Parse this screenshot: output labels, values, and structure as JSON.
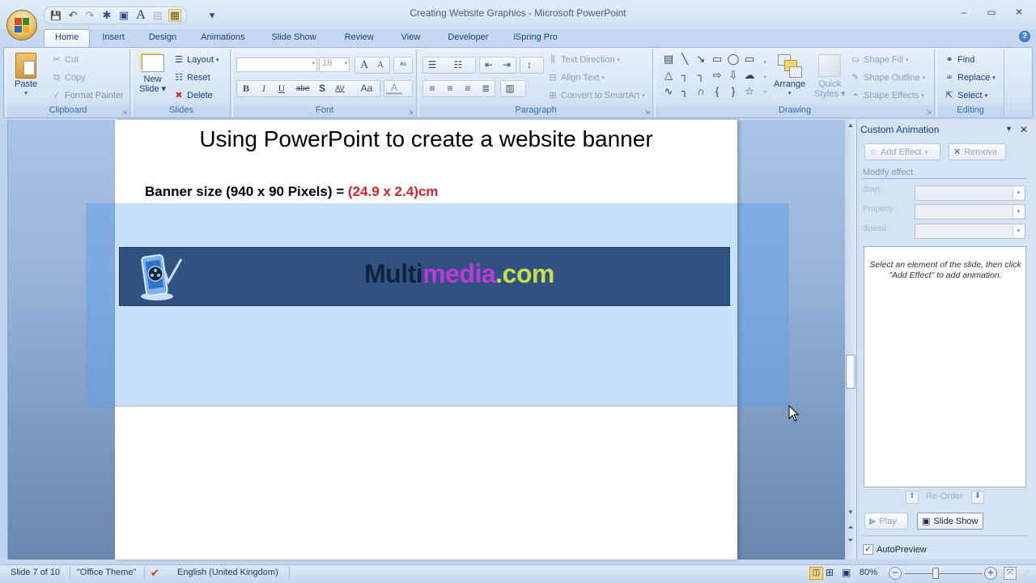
{
  "window": {
    "title": "Creating Website Graphics - Microsoft PowerPoint",
    "controls": {
      "minimize": "–",
      "maximize": "▭",
      "close": "✕"
    }
  },
  "quick_access": [
    {
      "name": "save-icon",
      "glyph": "💾"
    },
    {
      "name": "undo-icon",
      "glyph": "↶"
    },
    {
      "name": "redo-icon",
      "glyph": "↷"
    },
    {
      "name": "shapes-icon",
      "glyph": "✱"
    },
    {
      "name": "picture-icon",
      "glyph": "▣"
    },
    {
      "name": "wordart-icon",
      "glyph": "A"
    },
    {
      "name": "textbox-icon",
      "glyph": "▤"
    },
    {
      "name": "slideshow-icon",
      "glyph": "▦"
    },
    {
      "name": "customize-qat-icon",
      "glyph": "▾"
    }
  ],
  "tabs": [
    "Home",
    "Insert",
    "Design",
    "Animations",
    "Slide Show",
    "Review",
    "View",
    "Developer",
    "iSpring Pro"
  ],
  "active_tab": "Home",
  "ribbon": {
    "clipboard": {
      "label": "Clipboard",
      "paste": "Paste",
      "cut": "Cut",
      "copy": "Copy",
      "format_painter": "Format Painter"
    },
    "slides": {
      "label": "Slides",
      "new_slide_1": "New",
      "new_slide_2": "Slide",
      "layout": "Layout",
      "reset": "Reset",
      "delete": "Delete"
    },
    "font": {
      "label": "Font",
      "font_name": "",
      "font_size": "18",
      "bold": "B",
      "italic": "I",
      "underline": "U",
      "strike": "abe",
      "shadow": "S",
      "spacing": "AV",
      "case": "Aa",
      "grow": "A",
      "shrink": "A",
      "clear": "A"
    },
    "paragraph": {
      "label": "Paragraph",
      "text_direction": "Text Direction",
      "align_text": "Align Text",
      "convert_smartart": "Convert to SmartArt"
    },
    "drawing": {
      "label": "Drawing",
      "arrange": "Arrange",
      "quick_styles_1": "Quick",
      "quick_styles_2": "Styles",
      "shape_fill": "Shape Fill",
      "shape_outline": "Shape Outline",
      "shape_effects": "Shape Effects",
      "shapes": [
        "▤",
        "╲",
        "↘",
        "▭",
        "◯",
        "▭",
        "△",
        "┐",
        "┐",
        "⇨",
        "⇩",
        "☁",
        "∿",
        "╮",
        "∩",
        "{",
        "}",
        "☆"
      ]
    },
    "editing": {
      "label": "Editing",
      "find": "Find",
      "replace": "Replace",
      "select": "Select"
    }
  },
  "slide": {
    "title": "Using PowerPoint to create a website banner",
    "banner_size_label": "Banner size (940 x 90 Pixels) = ",
    "banner_size_value": "(24.9 x  2.4)cm",
    "banner": {
      "text_part1": "Multi",
      "text_part2": "media",
      "text_part3": ".com",
      "colors": {
        "part1": "#14213d",
        "part2": "#c038d8",
        "part3": "#c8dc4c",
        "background": "#2f5280"
      }
    }
  },
  "task_pane": {
    "title": "Custom Animation",
    "add_effect": "Add Effect",
    "remove": "Remove",
    "modify_effect": "Modify effect",
    "start_label": "Start:",
    "property_label": "Property:",
    "speed_label": "Speed:",
    "start_value": "",
    "property_value": "",
    "speed_value": "",
    "hint": "Select an element of the slide, then click \"Add Effect\" to add animation.",
    "reorder": "Re-Order",
    "play": "Play",
    "slide_show": "Slide Show",
    "autopreview": "AutoPreview",
    "autopreview_checked": true
  },
  "status_bar": {
    "slide_info": "Slide 7 of 10",
    "theme": "\"Office Theme\"",
    "language": "English (United Kingdom)",
    "zoom": "80%",
    "zoom_fraction": 0.4
  }
}
